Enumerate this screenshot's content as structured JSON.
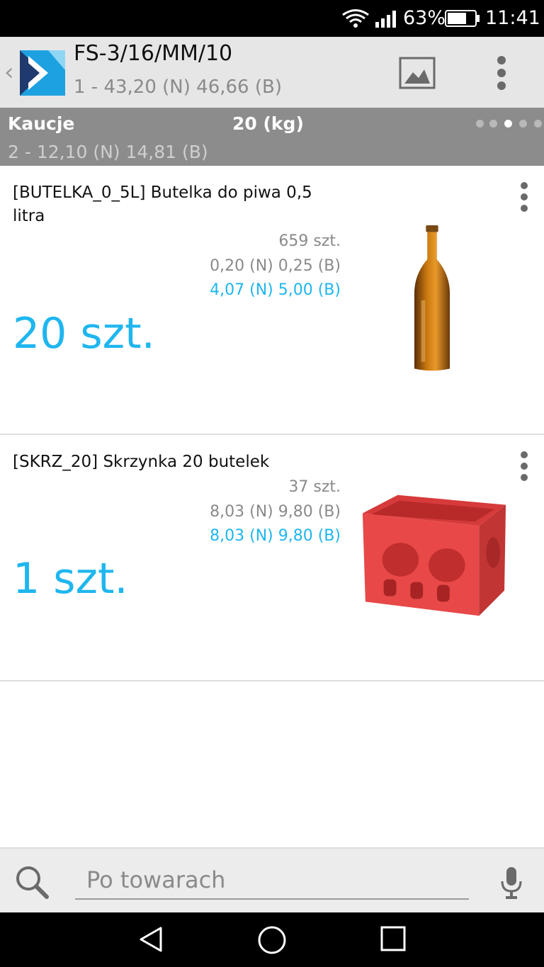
{
  "status_bar": {
    "battery_percent": "63%",
    "time": "11:41",
    "icons": [
      "wifi-icon",
      "signal-icon",
      "battery-icon"
    ]
  },
  "header": {
    "back_icon": "chevron-left-icon",
    "logo_icon": "app-logo",
    "title": "FS-3/16/MM/10",
    "subtitle": "1 - 43,20 (N) 46,66 (B)",
    "image_icon": "image-icon",
    "menu_icon": "more-vert-icon"
  },
  "section": {
    "label": "Kaucje",
    "weight": "20 (kg)",
    "summary": "2 - 12,10 (N) 14,81 (B)",
    "page_dots": 5,
    "active_dot": 3
  },
  "products": [
    {
      "name": "[BUTELKA_0_5L] Butelka do piwa 0,5 litra",
      "stock": "659 szt.",
      "unit_price": "0,20 (N)  0,25 (B)",
      "total_price": "4,07 (N) 5,00 (B)",
      "quantity": "20 szt.",
      "image": "beer-bottle"
    },
    {
      "name": "[SKRZ_20] Skrzynka 20 butelek",
      "stock": "37 szt.",
      "unit_price": "8,03 (N)  9,80 (B)",
      "total_price": "8,03 (N) 9,80 (B)",
      "quantity": "1 szt.",
      "image": "bottle-crate"
    }
  ],
  "search": {
    "placeholder": "Po towarach",
    "value": "",
    "icons": [
      "search-icon",
      "mic-icon"
    ]
  },
  "nav": {
    "icons": [
      "back-icon",
      "home-icon",
      "recents-icon"
    ]
  },
  "colors": {
    "accent": "#1fb6ef",
    "section_bg": "#8c8c8c",
    "header_bg": "#e6e6e6"
  }
}
